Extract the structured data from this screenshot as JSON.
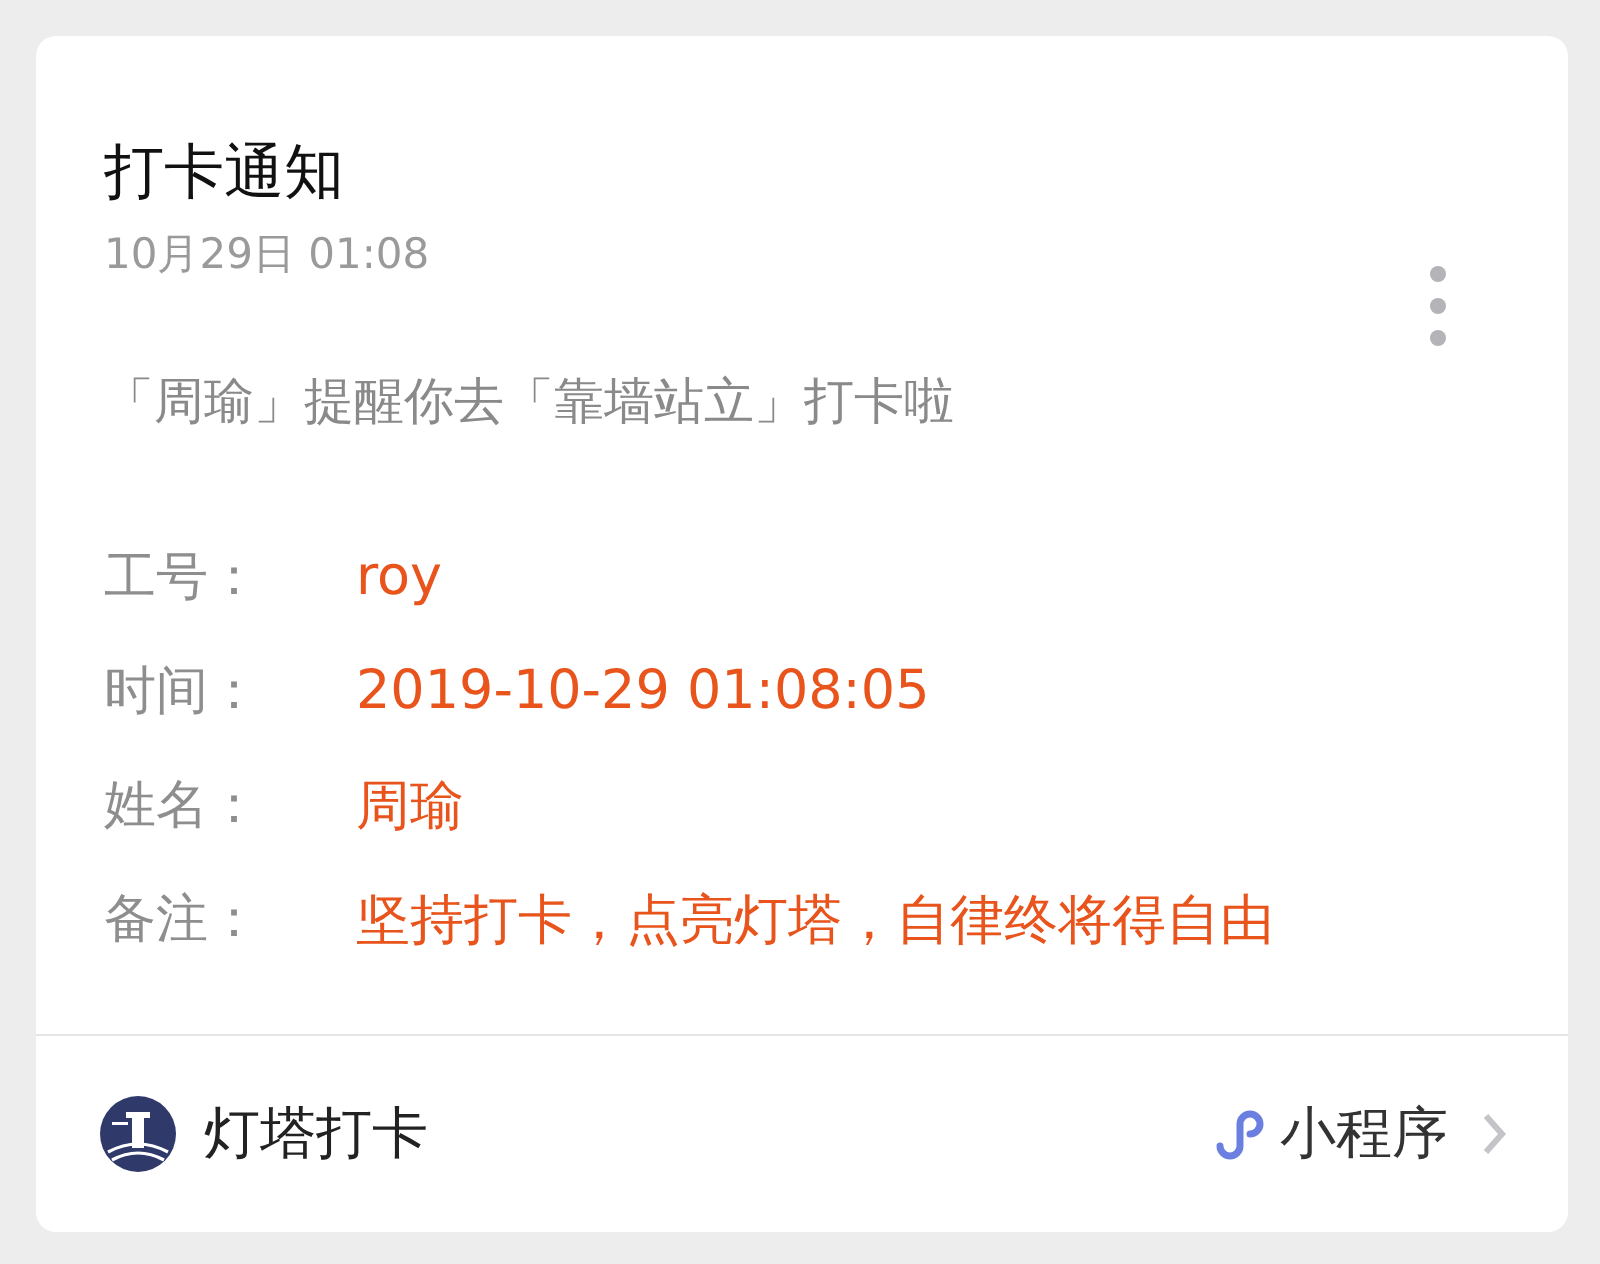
{
  "card": {
    "title": "打卡通知",
    "time": "10月29日  01:08",
    "message": "「周瑜」提醒你去「靠墙站立」打卡啦",
    "fields": [
      {
        "label": "工号：",
        "value": "roy"
      },
      {
        "label": "时间：",
        "value": "2019-10-29 01:08:05"
      },
      {
        "label": "姓名：",
        "value": "周瑜"
      },
      {
        "label": "备注：",
        "value": "坚持打卡，点亮灯塔，自律终将得自由"
      }
    ]
  },
  "footer": {
    "app_name": "灯塔打卡",
    "type_label": "小程序"
  }
}
